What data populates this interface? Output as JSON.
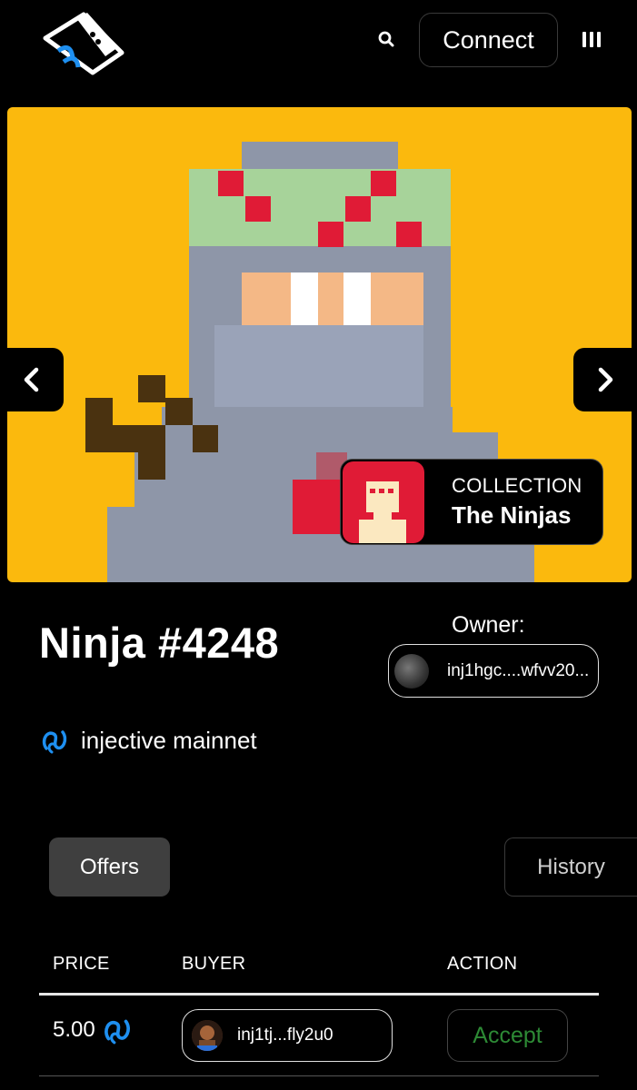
{
  "header": {
    "connect_label": "Connect",
    "icons": [
      "logo-icon",
      "search-icon",
      "menu-icon"
    ]
  },
  "hero": {
    "icons": [
      "chevron-left-icon",
      "chevron-right-icon"
    ],
    "collection": {
      "label": "COLLECTION",
      "name": "The Ninjas"
    },
    "colors": {
      "background": "#fbb90d",
      "collection_thumb": "#e01b36"
    }
  },
  "nft": {
    "title": "Ninja #4248",
    "owner_label": "Owner:",
    "owner_address": "inj1hgc....wfvv20...",
    "network": "injective mainnet"
  },
  "tabs": [
    {
      "label": "Offers",
      "active": true
    },
    {
      "label": "History",
      "active": false
    }
  ],
  "offers_table": {
    "columns": [
      "PRICE",
      "BUYER",
      "ACTION"
    ],
    "rows": [
      {
        "price": "5.00",
        "buyer": "inj1tj...fly2u0",
        "action": "Accept"
      }
    ]
  },
  "colors": {
    "accept_text": "#2d8a35",
    "injective_blue": "#1e8ff0"
  }
}
